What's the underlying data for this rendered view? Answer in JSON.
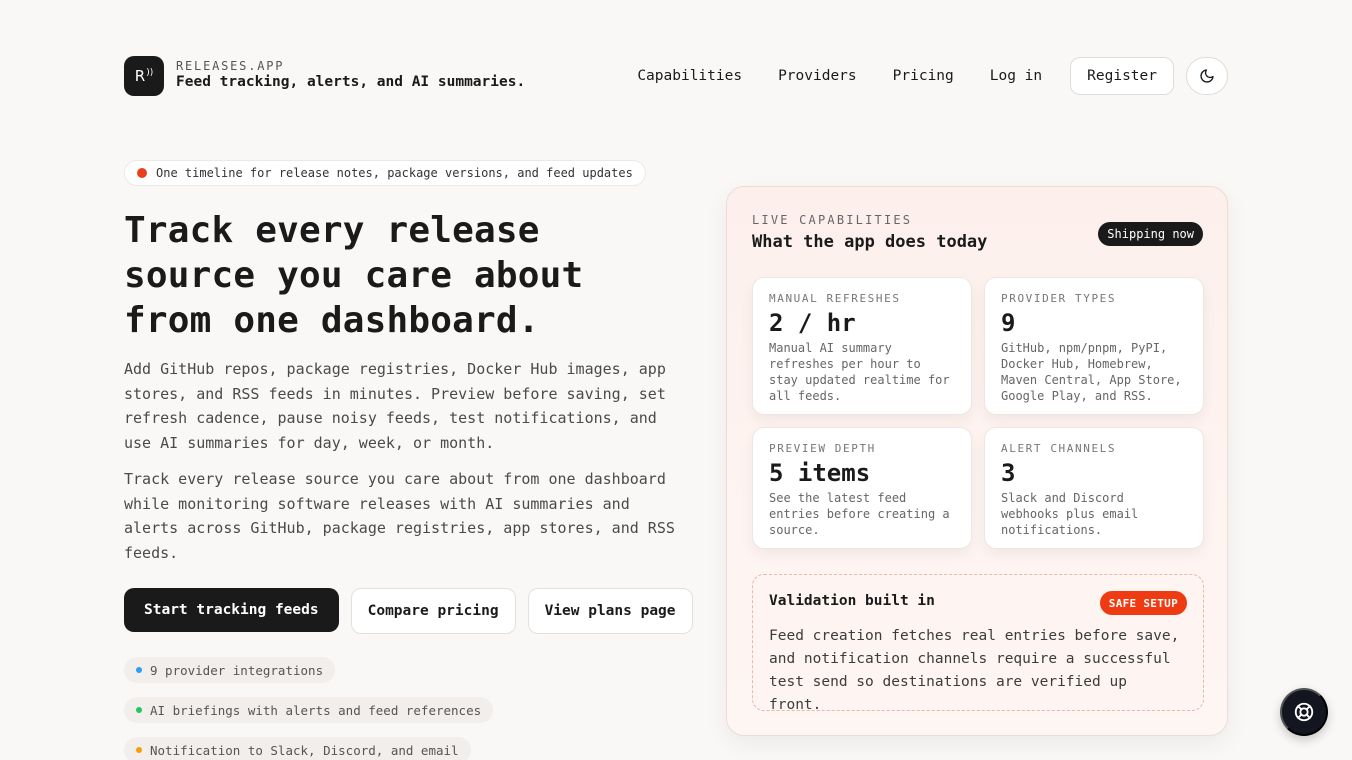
{
  "brand": {
    "logo_letter": "R",
    "name": "RELEASES.APP",
    "tagline": "Feed tracking, alerts, and AI summaries."
  },
  "nav": {
    "links": [
      "Capabilities",
      "Providers",
      "Pricing",
      "Log in"
    ],
    "register": "Register",
    "theme_icon": "moon-icon"
  },
  "hero": {
    "pill": "One timeline for release notes, package versions, and feed updates",
    "title": "Track every release source you care about from one dashboard.",
    "paragraph1": "Add GitHub repos, package registries, Docker Hub images, app stores, and RSS feeds in minutes. Preview before saving, set refresh cadence, pause noisy feeds, test notifications, and use AI summaries for day, week, or month.",
    "paragraph2": "Track every release source you care about from one dashboard while monitoring software releases with AI summaries and alerts across GitHub, package registries, app stores, and RSS feeds.",
    "cta_primary": "Start tracking feeds",
    "cta_compare": "Compare pricing",
    "cta_plans": "View plans page",
    "features": [
      {
        "label": "9 provider integrations",
        "color": "#2a9df4"
      },
      {
        "label": "AI briefings with alerts and feed references",
        "color": "#22c55e"
      },
      {
        "label": "Notification to Slack, Discord, and email",
        "color": "#f59e0b"
      }
    ]
  },
  "card": {
    "eyebrow": "LIVE CAPABILITIES",
    "title": "What the app does today",
    "badge": "Shipping now",
    "stats": [
      {
        "label": "MANUAL REFRESHES",
        "value": "2 / hr",
        "desc": "Manual AI summary refreshes per hour to stay updated realtime for all feeds."
      },
      {
        "label": "PROVIDER TYPES",
        "value": "9",
        "desc": "GitHub, npm/pnpm, PyPI, Docker Hub, Homebrew, Maven Central, App Store, Google Play, and RSS."
      },
      {
        "label": "PREVIEW DEPTH",
        "value": "5 items",
        "desc": "See the latest feed entries before creating a source."
      },
      {
        "label": "ALERT CHANNELS",
        "value": "3",
        "desc": "Slack and Discord webhooks plus email notifications."
      }
    ],
    "validation": {
      "title": "Validation built in",
      "badge": "SAFE SETUP",
      "text": "Feed creation fetches real entries before save, and notification channels require a successful test send so destinations are verified up front."
    }
  },
  "help_icon": "lifebuoy-icon",
  "colors": {
    "accent": "#ef3b12",
    "dark": "#1a1a1a",
    "background": "#faf8f6"
  }
}
